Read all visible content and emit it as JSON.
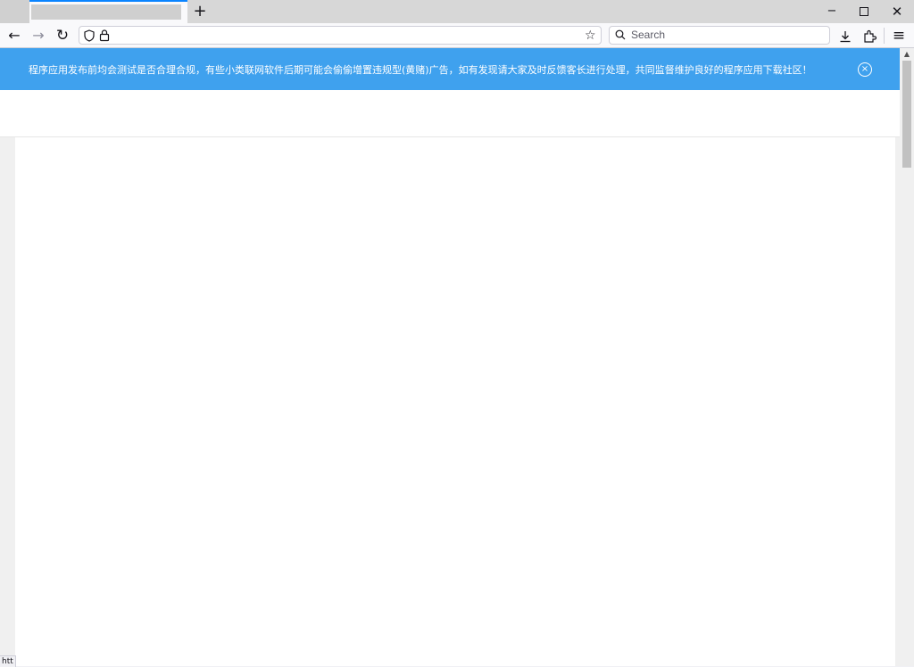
{
  "browser": {
    "tab": {
      "title": ""
    },
    "new_tab_symbol": "+",
    "window_controls": {
      "minimize": "−",
      "close": "✕"
    },
    "nav": {
      "back": "←",
      "forward": "→",
      "reload": "↻"
    },
    "url": "",
    "search": {
      "placeholder": "Search"
    },
    "icons": [
      "shield-icon",
      "lock-icon",
      "star-icon",
      "search-icon",
      "download-icon",
      "extensions-icon",
      "menu-icon"
    ],
    "status_text": "htt"
  },
  "page": {
    "notice": {
      "text": "程序应用发布前均会测试是否合理合规，有些小类联网软件后期可能会偷偷增置违规型(黄赌)广告，如有发现请大家及时反馈客长进行处理，共同监督维护良好的程序应用下载社区！",
      "close_symbol": "×",
      "background": "#3fa1ee"
    }
  },
  "colors": {
    "accent": "#0a84ff",
    "notice_bg": "#3fa1ee"
  }
}
